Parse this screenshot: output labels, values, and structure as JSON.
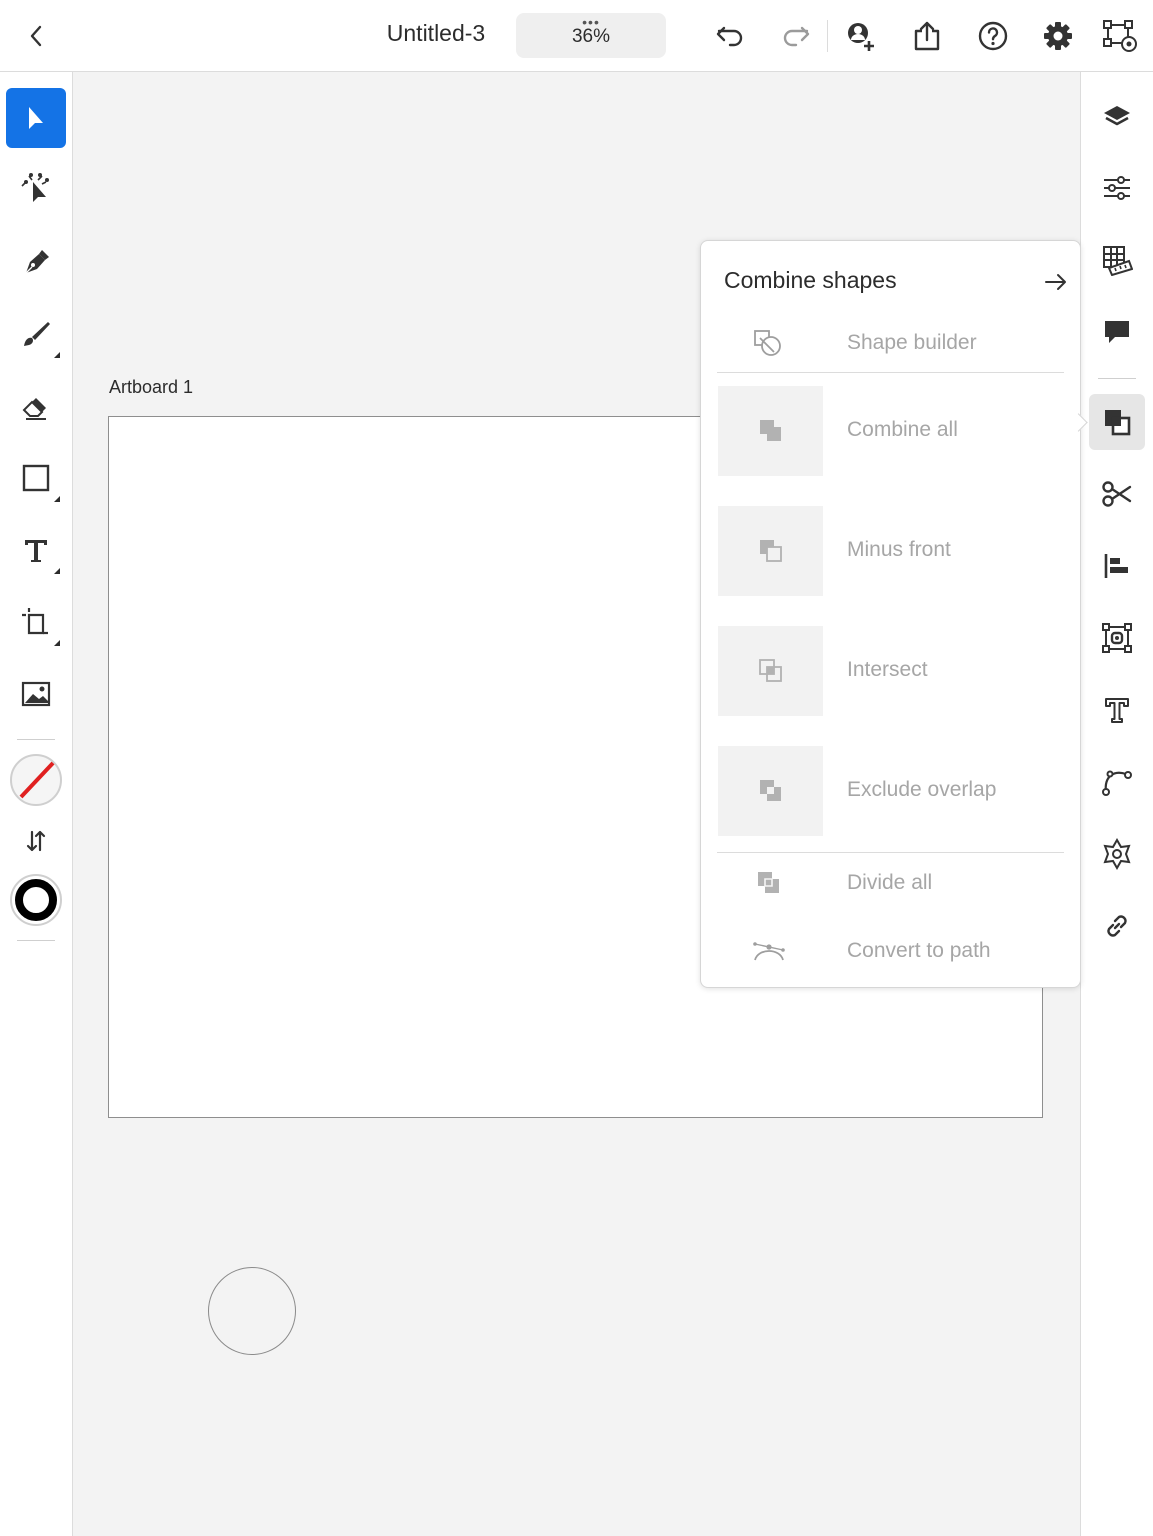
{
  "topbar": {
    "document_title": "Untitled-3",
    "zoom": "36%",
    "zoom_dots": "•••",
    "icons": [
      "back-icon",
      "undo-icon",
      "redo-icon",
      "invite-user-icon",
      "share-icon",
      "help-icon",
      "settings-icon",
      "artboard-preview-icon"
    ]
  },
  "left_toolbar": {
    "tools": [
      "select",
      "direct-select",
      "pen",
      "brush",
      "eraser",
      "rectangle",
      "text",
      "crop",
      "image"
    ],
    "active_tool": "select",
    "fill": "none",
    "stroke_color": "#000000"
  },
  "right_toolbar": {
    "panels": [
      "layers",
      "properties",
      "grids",
      "comments",
      "combine-shapes",
      "scissors",
      "align",
      "repeat",
      "type",
      "path",
      "shape",
      "link"
    ],
    "active_panel": "combine-shapes"
  },
  "canvas": {
    "artboard_label": "Artboard 1"
  },
  "combine_panel": {
    "title": "Combine shapes",
    "items": [
      {
        "label": "Shape builder",
        "icon": "shape-builder-icon"
      },
      {
        "label": "Combine all",
        "icon": "combine-all-icon"
      },
      {
        "label": "Minus front",
        "icon": "minus-front-icon"
      },
      {
        "label": "Intersect",
        "icon": "intersect-icon"
      },
      {
        "label": "Exclude overlap",
        "icon": "exclude-overlap-icon"
      },
      {
        "label": "Divide all",
        "icon": "divide-all-icon"
      },
      {
        "label": "Convert to path",
        "icon": "convert-to-path-icon"
      }
    ]
  },
  "colors": {
    "accent": "#1473e6",
    "disabled_text": "#a6a6a6",
    "canvas_bg": "#f3f3f3",
    "no_fill_slash": "#e02020"
  }
}
